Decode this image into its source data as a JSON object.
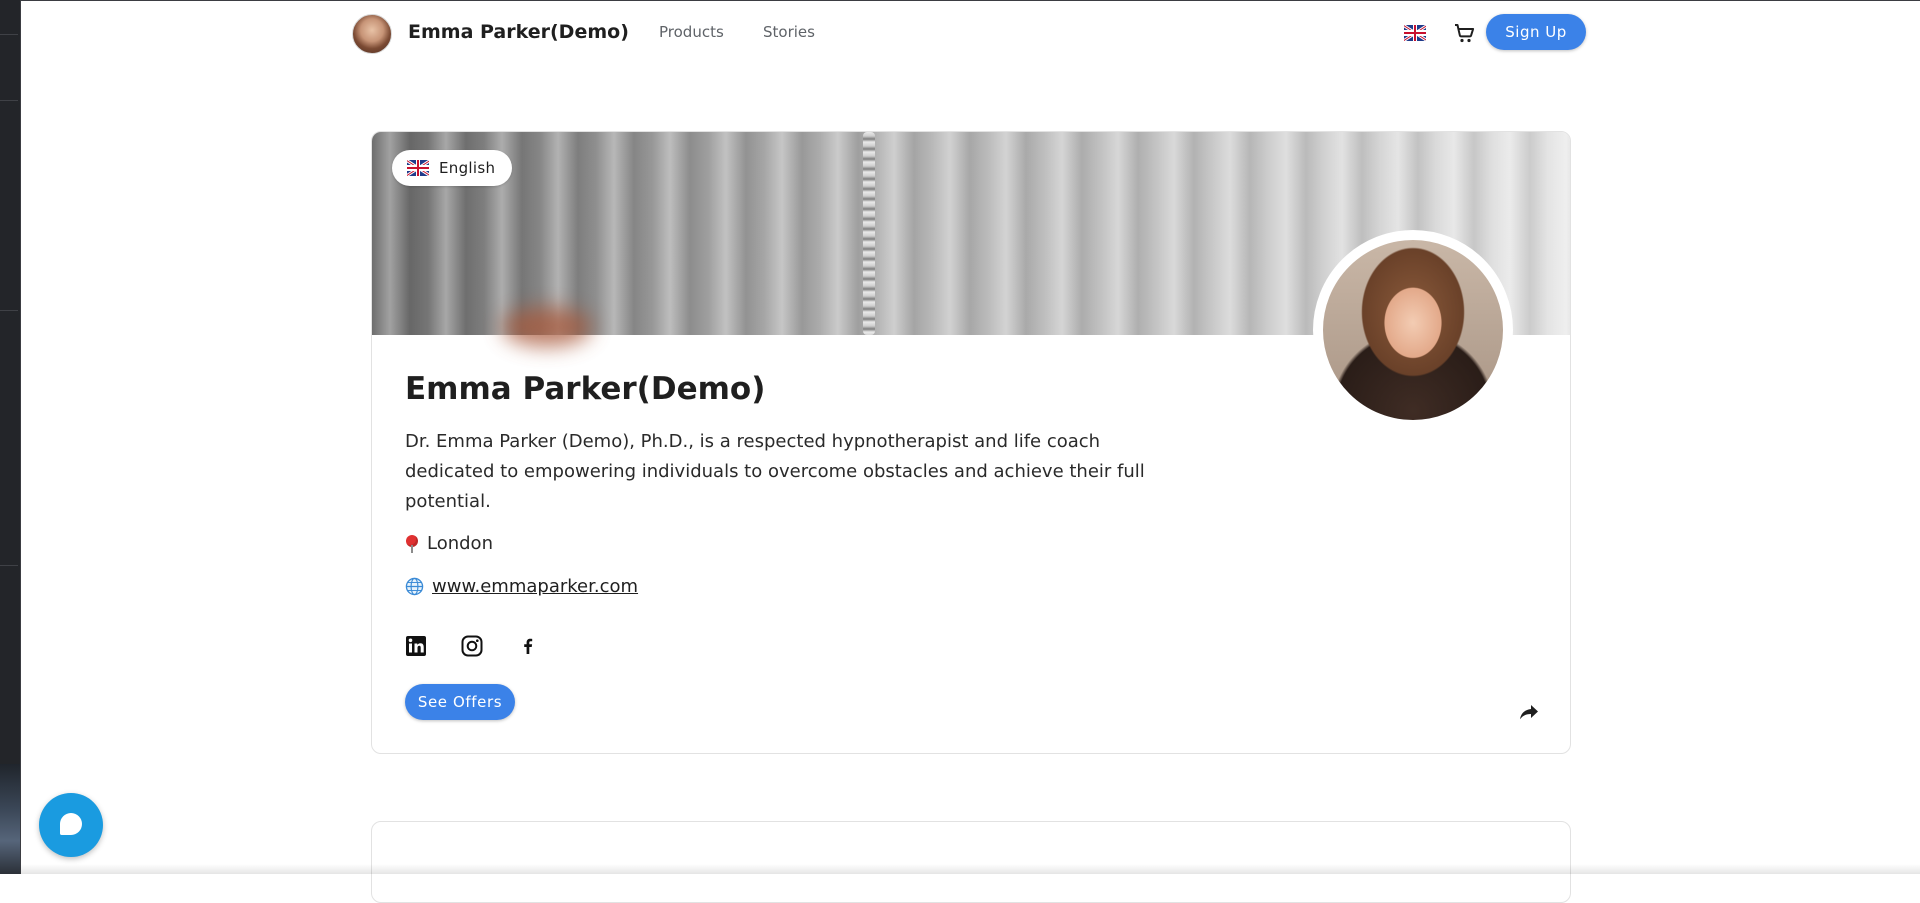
{
  "header": {
    "brand_name": "Emma Parker(Demo)",
    "nav": [
      {
        "label": "Products"
      },
      {
        "label": "Stories"
      }
    ],
    "signup_label": "Sign Up"
  },
  "profile": {
    "language_label": "English",
    "name": "Emma Parker(Demo)",
    "bio": "Dr. Emma Parker (Demo), Ph.D., is a respected hypnotherapist and life coach dedicated to empowering individuals to overcome obstacles and achieve their full potential.",
    "location": "London",
    "website": "www.emmaparker.com",
    "offers_label": "See Offers",
    "social": [
      "linkedin-icon",
      "instagram-icon",
      "facebook-icon"
    ]
  },
  "colors": {
    "accent": "#3b82e8",
    "chat": "#1a9be0"
  }
}
